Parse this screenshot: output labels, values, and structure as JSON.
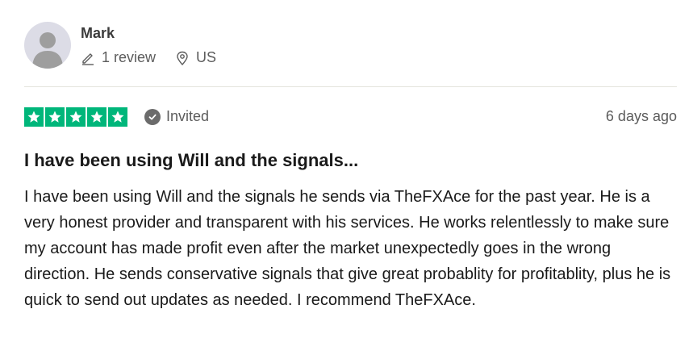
{
  "consumer": {
    "avatar_icon": "user-silhouette-icon",
    "name": "Mark",
    "review_count_label": "1 review",
    "location": "US"
  },
  "review": {
    "rating": 5,
    "rating_max": 5,
    "star_color": "#00b67a",
    "invited_label": "Invited",
    "date": "6 days ago",
    "title": "I have been using Will and the signals...",
    "text": "I have been using Will and the signals he sends via TheFXAce for the past year. He is a very honest provider and transparent with his services. He works relentlessly to make sure my account has made profit even after the market unexpectedly goes in the wrong direction. He sends conservative signals that give great probablity for profitablity, plus he is quick to send out updates as needed. I recommend TheFXAce."
  }
}
